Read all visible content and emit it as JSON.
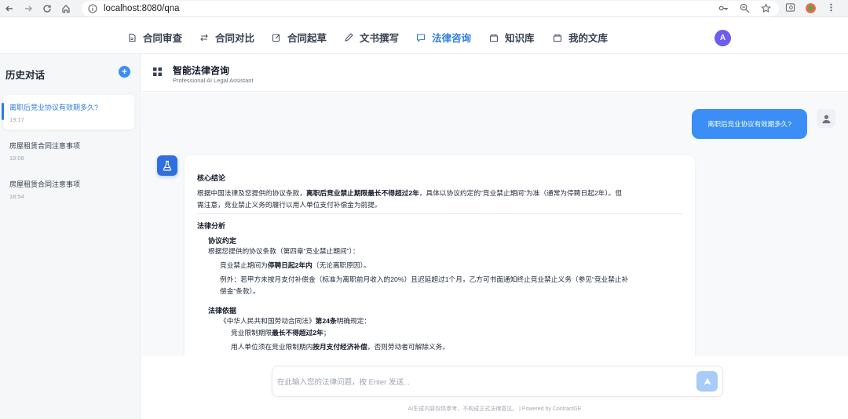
{
  "browser": {
    "url": "localhost:8080/qna"
  },
  "nav": {
    "items": [
      {
        "label": "合同审查",
        "icon": "document-icon"
      },
      {
        "label": "合同对比",
        "icon": "swap-icon"
      },
      {
        "label": "合同起草",
        "icon": "edit-icon"
      },
      {
        "label": "文书撰写",
        "icon": "pen-icon"
      },
      {
        "label": "法律咨询",
        "icon": "chat-icon",
        "active": true
      },
      {
        "label": "知识库",
        "icon": "folder-icon"
      },
      {
        "label": "我的文库",
        "icon": "folder-icon"
      }
    ],
    "user_initial": "A"
  },
  "sidebar": {
    "title": "历史对话",
    "new_label": "+",
    "conversations": [
      {
        "title": "离职后竞业协议有效期多久?",
        "time": "19:17",
        "active": true
      },
      {
        "title": "房屋租赁合同注意事项",
        "time": "19:08"
      },
      {
        "title": "房屋租赁合同注意事项",
        "time": "18:54"
      }
    ]
  },
  "header": {
    "title": "智能法律咨询",
    "subtitle": "Professional AI Legal Assistant"
  },
  "chat": {
    "user_message": "离职后竞业协议有效期多久?",
    "answer": {
      "s1_title": "核心结论",
      "s1_p1_a": "根据中国法律及您提供的协议条款，",
      "s1_p1_b": "离职后竞业禁止期限最长不得超过2年",
      "s1_p1_c": "，具体以协议约定的“竞业禁止期间”为准（通常为停聘日起2年）。但",
      "s1_p2": "需注意，竞业禁止义务的履行以用人单位支付补偿金为前提。",
      "s2_title": "法律分析",
      "s2_sub1": "协议约定",
      "s2_sub1_p1": "根据您提供的协议条款（第四章“竞业禁止期间”）：",
      "s2_sub1_p2_a": "竞业禁止期间为",
      "s2_sub1_p2_b": "停聘日起2年内",
      "s2_sub1_p2_c": "（无论离职原因）。",
      "s2_sub1_p3": "例外：若甲方未按月支付补偿金（标准为离职前月收入的20%）且迟延超过1个月，乙方可书面通知终止竞业禁止义务（参见“竞业禁止补",
      "s2_sub1_p4": "偿金”条款）。",
      "s2_sub2": "法律依据",
      "s2_sub2_p1_a": "《中华人民共和国劳动合同法》",
      "s2_sub2_p1_b": "第24条",
      "s2_sub2_p1_c": "明确规定：",
      "s2_sub2_p2_a": "竞业限制期限",
      "s2_sub2_p2_b": "最长不得超过2年",
      "s2_sub2_p2_c": "；",
      "s2_sub2_p3_a": "用人单位须在竞业限制期内",
      "s2_sub2_p3_b": "按月支付经济补偿",
      "s2_sub2_p3_c": "，否则劳动者可解除义务。"
    }
  },
  "input": {
    "placeholder": "在此输入您的法律问题，按 Enter 发送..."
  },
  "footer": {
    "text": "AI生成内容仅供参考，不构成正式法律意见。 | Powered by ContractGE"
  },
  "colors": {
    "accent": "#2f7de1",
    "bubble": "#3a8ef6",
    "avatar": "#6d5cf0"
  }
}
